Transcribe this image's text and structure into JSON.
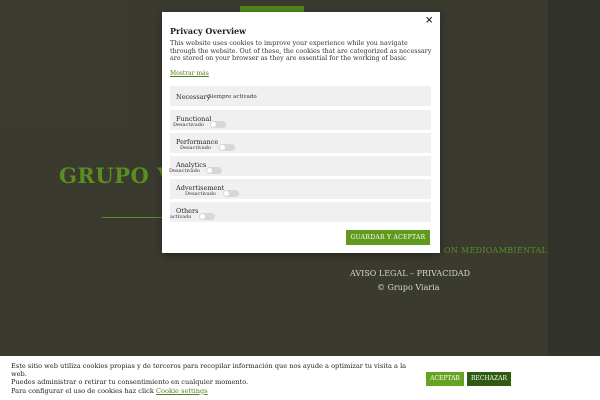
{
  "background": {
    "title": "GRUPO V",
    "green_text": "ON MEDIOAMBIENTAL",
    "legal": "AVISO LEGAL – PRIVACIDAD",
    "copyright": "© Grupo Viaria"
  },
  "modal": {
    "title": "Privacy Overview",
    "close_icon": "×",
    "description": "This website uses cookies to improve your experience while you navigate through the website. Out of these, the cookies that are categorized as necessary are stored on your browser as they are essential for the working of basic functionalities of the",
    "show_more": "Mostrar más",
    "categories": [
      {
        "label": "Necessary",
        "status": "Siempre activado"
      },
      {
        "label": "Functional",
        "status": "Desactivado"
      },
      {
        "label": "Performance",
        "status": "Desactivado"
      },
      {
        "label": "Analytics",
        "status": "Desactivado"
      },
      {
        "label": "Advertisement",
        "status": "Desactivado"
      },
      {
        "label": "Others",
        "status": "activado"
      }
    ],
    "save_button": "GUARDAR Y ACEPTAR"
  },
  "cookie_bar": {
    "line1": "Este sitio web utiliza cookies propias y de terceros para recopilar información que nos ayude a optimizar tu visita a la web.",
    "line2": "Puedes administrar o retirar tu consentimiento en cualquier momento.",
    "line3": "Para configurar el uso de cookies haz click",
    "link": "Cookie settings",
    "accept": "ACEPTAR",
    "reject": "RECHAZAR"
  },
  "colors": {
    "accent": "#67a225",
    "dark_accent": "#2e5a12",
    "background": "#434336"
  }
}
